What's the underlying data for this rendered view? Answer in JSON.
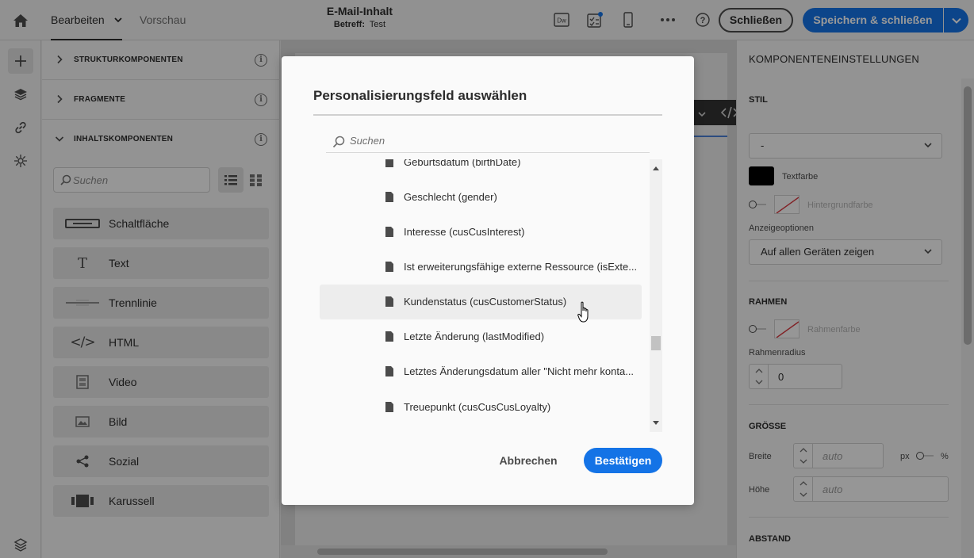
{
  "topbar": {
    "tab_edit": "Bearbeiten",
    "tab_preview": "Vorschau",
    "title": "E-Mail-Inhalt",
    "subject_label": "Betreff:",
    "subject_value": "Test",
    "dw_icon_text": "Dw",
    "close_label": "Schließen",
    "save_close_label": "Speichern & schließen",
    "help_icon_text": "?"
  },
  "left_panel": {
    "sections": [
      {
        "title": "STRUKTURKOMPONENTEN",
        "expanded": false
      },
      {
        "title": "FRAGMENTE",
        "expanded": false
      },
      {
        "title": "INHALTSKOMPONENTEN",
        "expanded": true
      }
    ],
    "info_glyph": "i",
    "search_placeholder": "Suchen",
    "components": [
      {
        "label": "Schaltfläche",
        "icon": "button-icon"
      },
      {
        "label": "Text",
        "icon": "text-icon",
        "glyph": "T"
      },
      {
        "label": "Trennlinie",
        "icon": "divider-icon"
      },
      {
        "label": "HTML",
        "icon": "code-icon",
        "glyph": "</>"
      },
      {
        "label": "Video",
        "icon": "video-icon"
      },
      {
        "label": "Bild",
        "icon": "image-icon"
      },
      {
        "label": "Sozial",
        "icon": "share-icon"
      },
      {
        "label": "Karussell",
        "icon": "carousel-icon"
      }
    ]
  },
  "right_panel": {
    "title": "KOMPONENTENEINSTELLUNGEN",
    "stil_label": "STIL",
    "stil_value": "-",
    "text_color_label": "Textfarbe",
    "text_color": "#000000",
    "bg_color_label": "Hintergrundfarbe",
    "display_options_label": "Anzeigeoptionen",
    "display_options_value": "Auf allen Geräten zeigen",
    "border_heading": "RAHMEN",
    "border_color_label": "Rahmenfarbe",
    "border_radius_label": "Rahmenradius",
    "border_radius_value": "0",
    "size_heading": "GRÖSSE",
    "width_label": "Breite",
    "width_placeholder": "auto",
    "unit_px": "px",
    "unit_pct": "%",
    "height_label": "Höhe",
    "height_placeholder": "auto",
    "spacing_heading": "ABSTAND"
  },
  "modal": {
    "title": "Personalisierungsfeld auswählen",
    "search_placeholder": "Suchen",
    "items": [
      "Geburtsdatum (birthDate)",
      "Geschlecht (gender)",
      "Interesse (cusCusInterest)",
      "Ist erweiterungsfähige externe Ressource (isExte...",
      "Kundenstatus (cusCustomerStatus)",
      "Letzte Änderung (lastModified)",
      "Letztes Änderungsdatum aller \"Nicht mehr konta...",
      "Treuepunkt (cusCusCusLoyalty)"
    ],
    "highlighted_index": 4,
    "cancel_label": "Abbrechen",
    "confirm_label": "Bestätigen"
  },
  "colors": {
    "accent": "#1473e6",
    "overlay": "rgba(0,0,0,0.40)"
  }
}
